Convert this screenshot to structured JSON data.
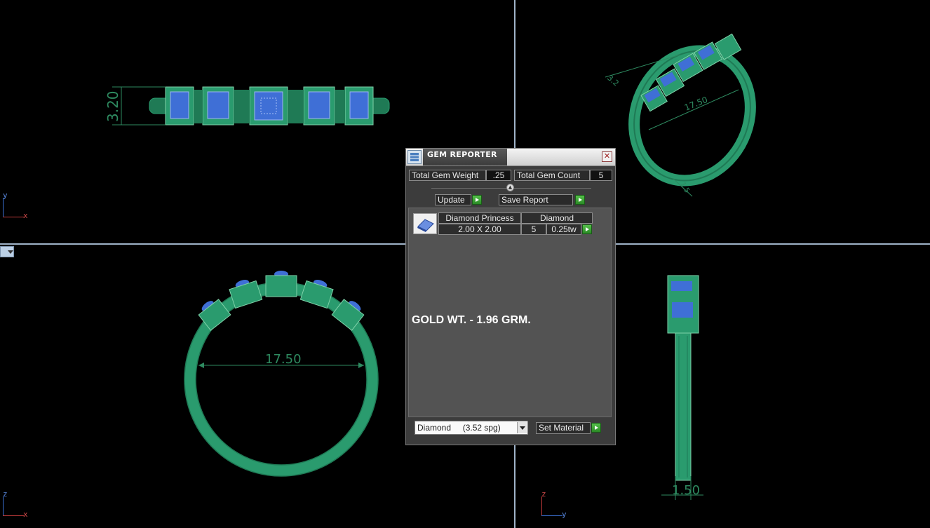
{
  "viewports": {
    "top": {
      "dimension_label": "3.20",
      "axis": {
        "vertical": "y",
        "horizontal": "x"
      }
    },
    "perspective": {
      "dimension_label": "17.50",
      "small_label_1": "3.2",
      "small_label_2": "1.5"
    },
    "front": {
      "dimension_label": "17.50",
      "axis": {
        "vertical": "z",
        "horizontal": "x"
      }
    },
    "side": {
      "dimension_label": "1.50",
      "axis": {
        "vertical": "z",
        "horizontal": "y"
      }
    }
  },
  "gem_reporter": {
    "title": "GEM REPORTER",
    "close_symbol": "✕",
    "total_gem_weight_label": "Total Gem Weight",
    "total_gem_weight_value": ".25",
    "total_gem_count_label": "Total Gem Count",
    "total_gem_count_value": "5",
    "update_label": "Update",
    "save_report_label": "Save Report",
    "gem_row": {
      "shape": "Diamond Princess",
      "material": "Diamond",
      "size": "2.00 X 2.00",
      "count": "5",
      "weight": "0.25tw"
    },
    "gold_note": "GOLD WT. - 1.96 GRM.",
    "material_select": "Diamond     (3.52 spg)",
    "set_material_label": "Set Material"
  },
  "colors": {
    "ring_green": "#2a9b6e",
    "ring_dark": "#1f7a55",
    "gem_blue": "#3f6fd6",
    "dimension_line": "#2e8a60"
  }
}
